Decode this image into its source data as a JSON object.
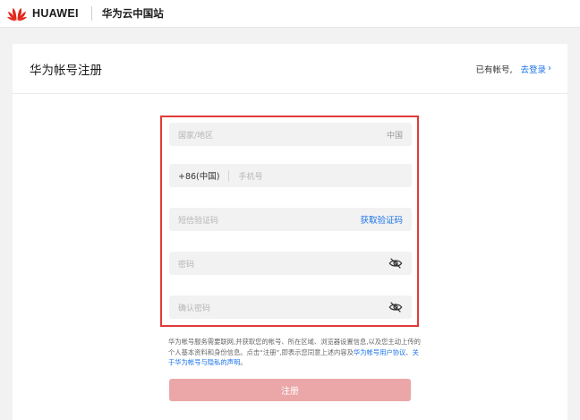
{
  "header": {
    "brand": "HUAWEI",
    "site_name": "华为云中国站"
  },
  "card": {
    "title": "华为帐号注册",
    "have_account": "已有帐号,",
    "login_link": "去登录"
  },
  "form": {
    "country_placeholder": "国家/地区",
    "country_value": "中国",
    "country_code": "+86(中国)",
    "phone_placeholder": "手机号",
    "sms_placeholder": "短信验证码",
    "get_code": "获取验证码",
    "password_placeholder": "密码",
    "confirm_placeholder": "确认密码"
  },
  "terms": {
    "text": "华为帐号服务需要联网,并获取您的帐号、所在区域、浏览器设置信息,以及您主动上传的个人基本资料和身份信息。点击“注册”,即表示您同意上述内容及",
    "link1": "华为帐号用户协议",
    "separator": "、",
    "link2": "关于华为帐号与隐私的声明",
    "end": "。"
  },
  "submit_label": "注册",
  "colors": {
    "brand_red": "#e1251b",
    "link_blue": "#1a73e8",
    "highlight_border": "#e03a3a",
    "submit_bg": "#eba6a7"
  }
}
